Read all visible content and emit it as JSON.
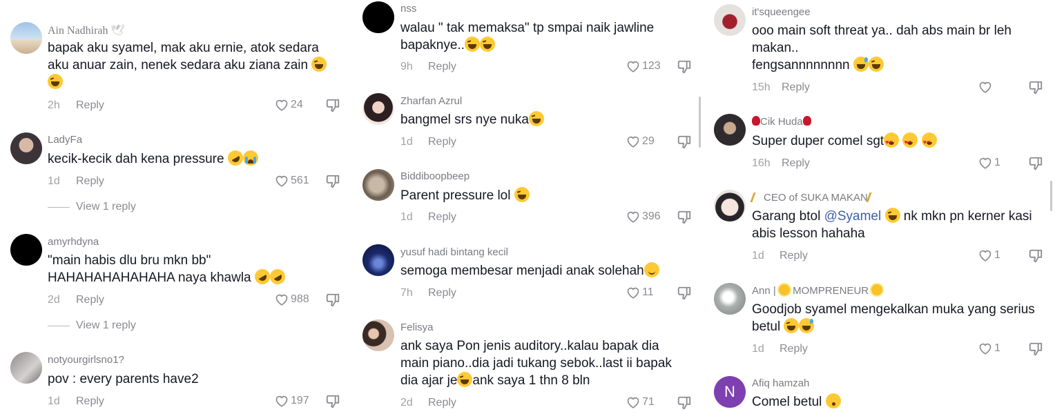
{
  "columns": [
    {
      "comments": [
        {
          "username": "Ain Nadhirah",
          "username_icon": "dove",
          "lines": [
            "bapak aku syamel, mak aku ernie, atok sedara",
            "aku anuar zain, nenek sedara aku ziana zain"
          ],
          "emojis_line2": [
            "laugh"
          ],
          "emojis_line3": [
            "laugh"
          ],
          "time": "2h",
          "reply": "Reply",
          "likes": "24",
          "view_replies": ""
        },
        {
          "username": "LadyFa",
          "lines": [
            "kecik-kecik dah kena pressure"
          ],
          "emojis_line1": [
            "rofl",
            "cry"
          ],
          "time": "1d",
          "reply": "Reply",
          "likes": "561",
          "view_replies": "View 1 reply"
        },
        {
          "username": "amyrhdyna",
          "lines": [
            "\"main habis dlu bru mkn bb\"",
            "HAHAHAHAHAHAHA naya khawla"
          ],
          "emojis_line2": [
            "rofl",
            "rofl"
          ],
          "time": "2d",
          "reply": "Reply",
          "likes": "988",
          "view_replies": "View 1 reply"
        },
        {
          "username": "notyourgirlsno1?",
          "lines": [
            "pov : every parents have2"
          ],
          "time": "1d",
          "reply": "Reply",
          "likes": "197",
          "view_replies": ""
        }
      ]
    },
    {
      "comments": [
        {
          "username": "nss",
          "lines": [
            "walau \" tak memaksa\" tp smpai naik jawline",
            "bapaknye.."
          ],
          "emojis_line2": [
            "laugh",
            "laugh"
          ],
          "time": "9h",
          "reply": "Reply",
          "likes": "123"
        },
        {
          "username": "Zharfan Azrul",
          "lines": [
            "bangmel srs nye nuka"
          ],
          "emojis_line1": [
            "laugh"
          ],
          "time": "1d",
          "reply": "Reply",
          "likes": "29"
        },
        {
          "username": "Biddiboopbeep",
          "lines": [
            "Parent pressure lol"
          ],
          "emojis_line1": [
            "laugh"
          ],
          "time": "1d",
          "reply": "Reply",
          "likes": "396"
        },
        {
          "username": "yusuf hadi bintang kecil",
          "lines": [
            "semoga membesar menjadi anak solehah"
          ],
          "emojis_line1": [
            "smile"
          ],
          "time": "7h",
          "reply": "Reply",
          "likes": "11"
        },
        {
          "username": "Felisya",
          "lines": [
            "ank saya Pon jenis auditory..kalau bapak dia",
            "main piano..dia jadi tukang sebok..last ii bapak",
            "dia ajar je",
            "ank saya 1 thn 8 bln"
          ],
          "time": "2d",
          "reply": "Reply",
          "likes": "71"
        }
      ]
    },
    {
      "comments": [
        {
          "username": "it'squeengee",
          "lines": [
            "ooo main soft threat ya.. dah abs main br leh",
            "makan..",
            "fengsannnnnnnn"
          ],
          "emojis_line3": [
            "sweat",
            "laugh"
          ],
          "time": "15h",
          "reply": "Reply",
          "likes": ""
        },
        {
          "username": "Cik Huda",
          "lines": [
            "Super duper comel sgt"
          ],
          "emojis_line1": [
            "heart",
            "heart",
            "heart"
          ],
          "time": "16h",
          "reply": "Reply",
          "likes": "1"
        },
        {
          "username": "CEO of SUKA MAKAN",
          "lines": [
            "Garang btol",
            "nk mkn pn kerner kasi",
            "abis lesson hahaha"
          ],
          "mention": "@Syamel",
          "time": "1d",
          "reply": "Reply",
          "likes": "1"
        },
        {
          "username_prefix": "Ann |",
          "username": "MOMPRENEUR",
          "lines": [
            "Goodjob syamel mengekalkan muka yang serius",
            "betul"
          ],
          "emojis_line2": [
            "laugh",
            "sweat"
          ],
          "time": "1d",
          "reply": "Reply",
          "likes": "1"
        },
        {
          "username": "Afiq hamzah",
          "avatar_letter": "N",
          "lines": [
            "Comel betul"
          ],
          "emojis_line1": [
            "hush"
          ]
        }
      ]
    }
  ],
  "colors": {
    "text": "#161823",
    "username": "#7a7b82",
    "meta": "#a0a1a6",
    "mention": "#3c5fa8",
    "avatar_letter_bg": "#7e3fb1"
  }
}
